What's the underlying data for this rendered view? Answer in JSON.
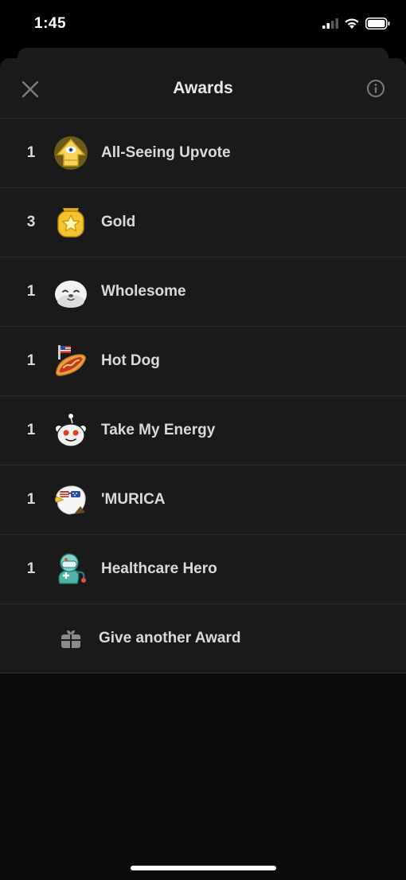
{
  "status_bar": {
    "time": "1:45",
    "icons": [
      "cellular-signal-icon",
      "wifi-icon",
      "battery-icon"
    ]
  },
  "header": {
    "title": "Awards",
    "close_icon": "close-icon",
    "info_icon": "info-icon"
  },
  "awards": [
    {
      "count": "1",
      "name": "All-Seeing Upvote",
      "icon": "all-seeing-upvote-icon"
    },
    {
      "count": "3",
      "name": "Gold",
      "icon": "gold-award-icon"
    },
    {
      "count": "1",
      "name": "Wholesome",
      "icon": "wholesome-seal-icon"
    },
    {
      "count": "1",
      "name": "Hot Dog",
      "icon": "hot-dog-icon"
    },
    {
      "count": "1",
      "name": "Take My Energy",
      "icon": "take-my-energy-icon"
    },
    {
      "count": "1",
      "name": "'MURICA",
      "icon": "murica-eagle-icon"
    },
    {
      "count": "1",
      "name": "Healthcare Hero",
      "icon": "healthcare-hero-icon"
    }
  ],
  "give_award": {
    "label": "Give another Award",
    "icon": "gift-icon"
  },
  "colors": {
    "sheet_background": "#1a1a1b",
    "divider": "#2b2b2d",
    "text": "#d7dadc",
    "gold": "#f4c430"
  }
}
